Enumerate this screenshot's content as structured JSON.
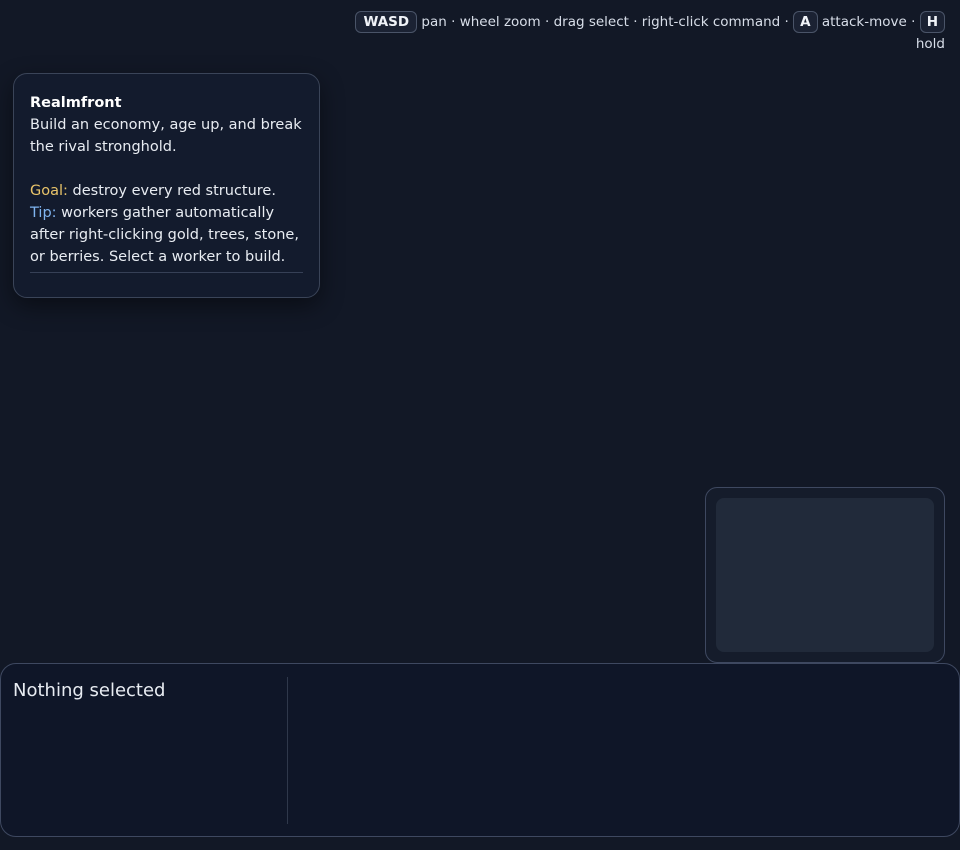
{
  "hints": {
    "key_wasd": "WASD",
    "text_main": " pan · wheel zoom · drag select · right-click command · ",
    "key_attack": "A",
    "text_attack": " attack-move · ",
    "key_hold": "H",
    "text_hold": "hold"
  },
  "info": {
    "title": "Realmfront",
    "intro": "Build an economy, age up, and break the rival stronghold.",
    "goal_label": "Goal:",
    "goal_text": " destroy every red structure.",
    "tip_label": "Tip:",
    "tip_text": " workers gather automatically after right-clicking gold, trees, stone, or berries. Select a worker to build."
  },
  "selection": {
    "title": "Nothing selected"
  },
  "colors": {
    "background": "#121826",
    "goal": "#e9c46a",
    "tip": "#7fb4f0"
  }
}
